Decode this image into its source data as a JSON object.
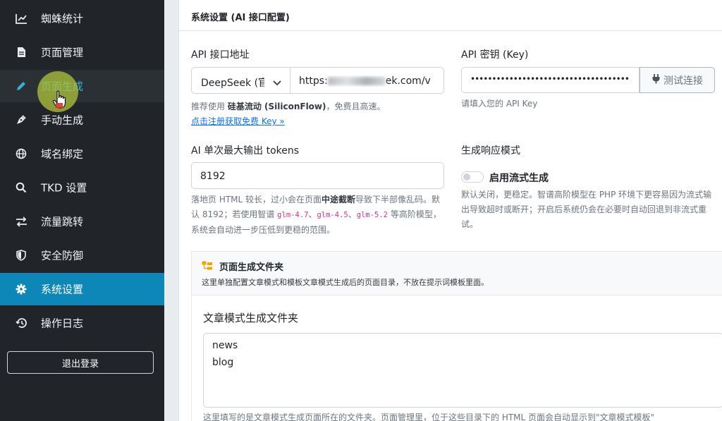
{
  "sidebar": {
    "items": [
      {
        "label": "蜘蛛统计",
        "icon": "chart-line-icon"
      },
      {
        "label": "页面管理",
        "icon": "file-icon"
      },
      {
        "label": "页面生成",
        "icon": "pencil-icon"
      },
      {
        "label": "手动生成",
        "icon": "pen-nib-icon"
      },
      {
        "label": "域名绑定",
        "icon": "globe-icon"
      },
      {
        "label": "TKD 设置",
        "icon": "search-icon"
      },
      {
        "label": "流量跳转",
        "icon": "arrows-exchange-icon"
      },
      {
        "label": "安全防御",
        "icon": "shield-icon"
      },
      {
        "label": "系统设置",
        "icon": "gear-icon"
      },
      {
        "label": "操作日志",
        "icon": "history-icon"
      }
    ],
    "logout_label": "退出登录"
  },
  "card": {
    "title": "系统设置 (AI 接口配置)"
  },
  "api_url": {
    "label": "API 接口地址",
    "provider_selected": "DeepSeek (官",
    "url_prefix": "https:",
    "url_suffix": "ek.com/v",
    "help_prefix": "推荐使用 ",
    "help_bold": "硅基流动 (SiliconFlow)",
    "help_suffix": "，免费且高速。",
    "register_link": "点击注册获取免费 Key »"
  },
  "api_key": {
    "label": "API 密钥 (Key)",
    "masked_value": "•••••••••••••••••••••••••••••••••••••",
    "test_button": "测试连接",
    "help": "请填入您的 API Key"
  },
  "max_tokens": {
    "label": "AI 单次最大输出 tokens",
    "value": "8192",
    "help_1": "落地页 HTML 较长，过小会在页面",
    "help_bold": "中途截断",
    "help_2": "导致下半部像乱码。默认 8192；若使用智谱 ",
    "code_1": "glm-4.7",
    "sep_1": "、",
    "code_2": "glm-4.5",
    "sep_2": "、",
    "code_3": "glm-5.2",
    "help_3": " 等高阶模型，系统会自动进一步压低到更稳的范围。"
  },
  "stream_mode": {
    "label": "生成响应模式",
    "toggle_label": "启用流式生成",
    "help": "默认关闭，更稳定。智谱高阶模型在 PHP 环境下更容易因为流式输出导致超时或断开；开启后系统仍会在必要时自动回退到非流式重试。"
  },
  "folder_section": {
    "title": "页面生成文件夹",
    "description": "这里单独配置文章模式和模板文章模式生成后的页面目录，不放在提示词模板里面。",
    "article_folder_label": "文章模式生成文件夹",
    "article_folders": "news\nblog",
    "bottom_help": "这里填写的是文章模式生成页面所在的文件夹。页面管理里，位于这些目录下的 HTML 页面会自动显示到\"文章模式模板\""
  },
  "colors": {
    "sidebar_bg": "#212529",
    "active_bg": "#0d86b8",
    "link": "#0d6efd",
    "code": "#d63384"
  }
}
